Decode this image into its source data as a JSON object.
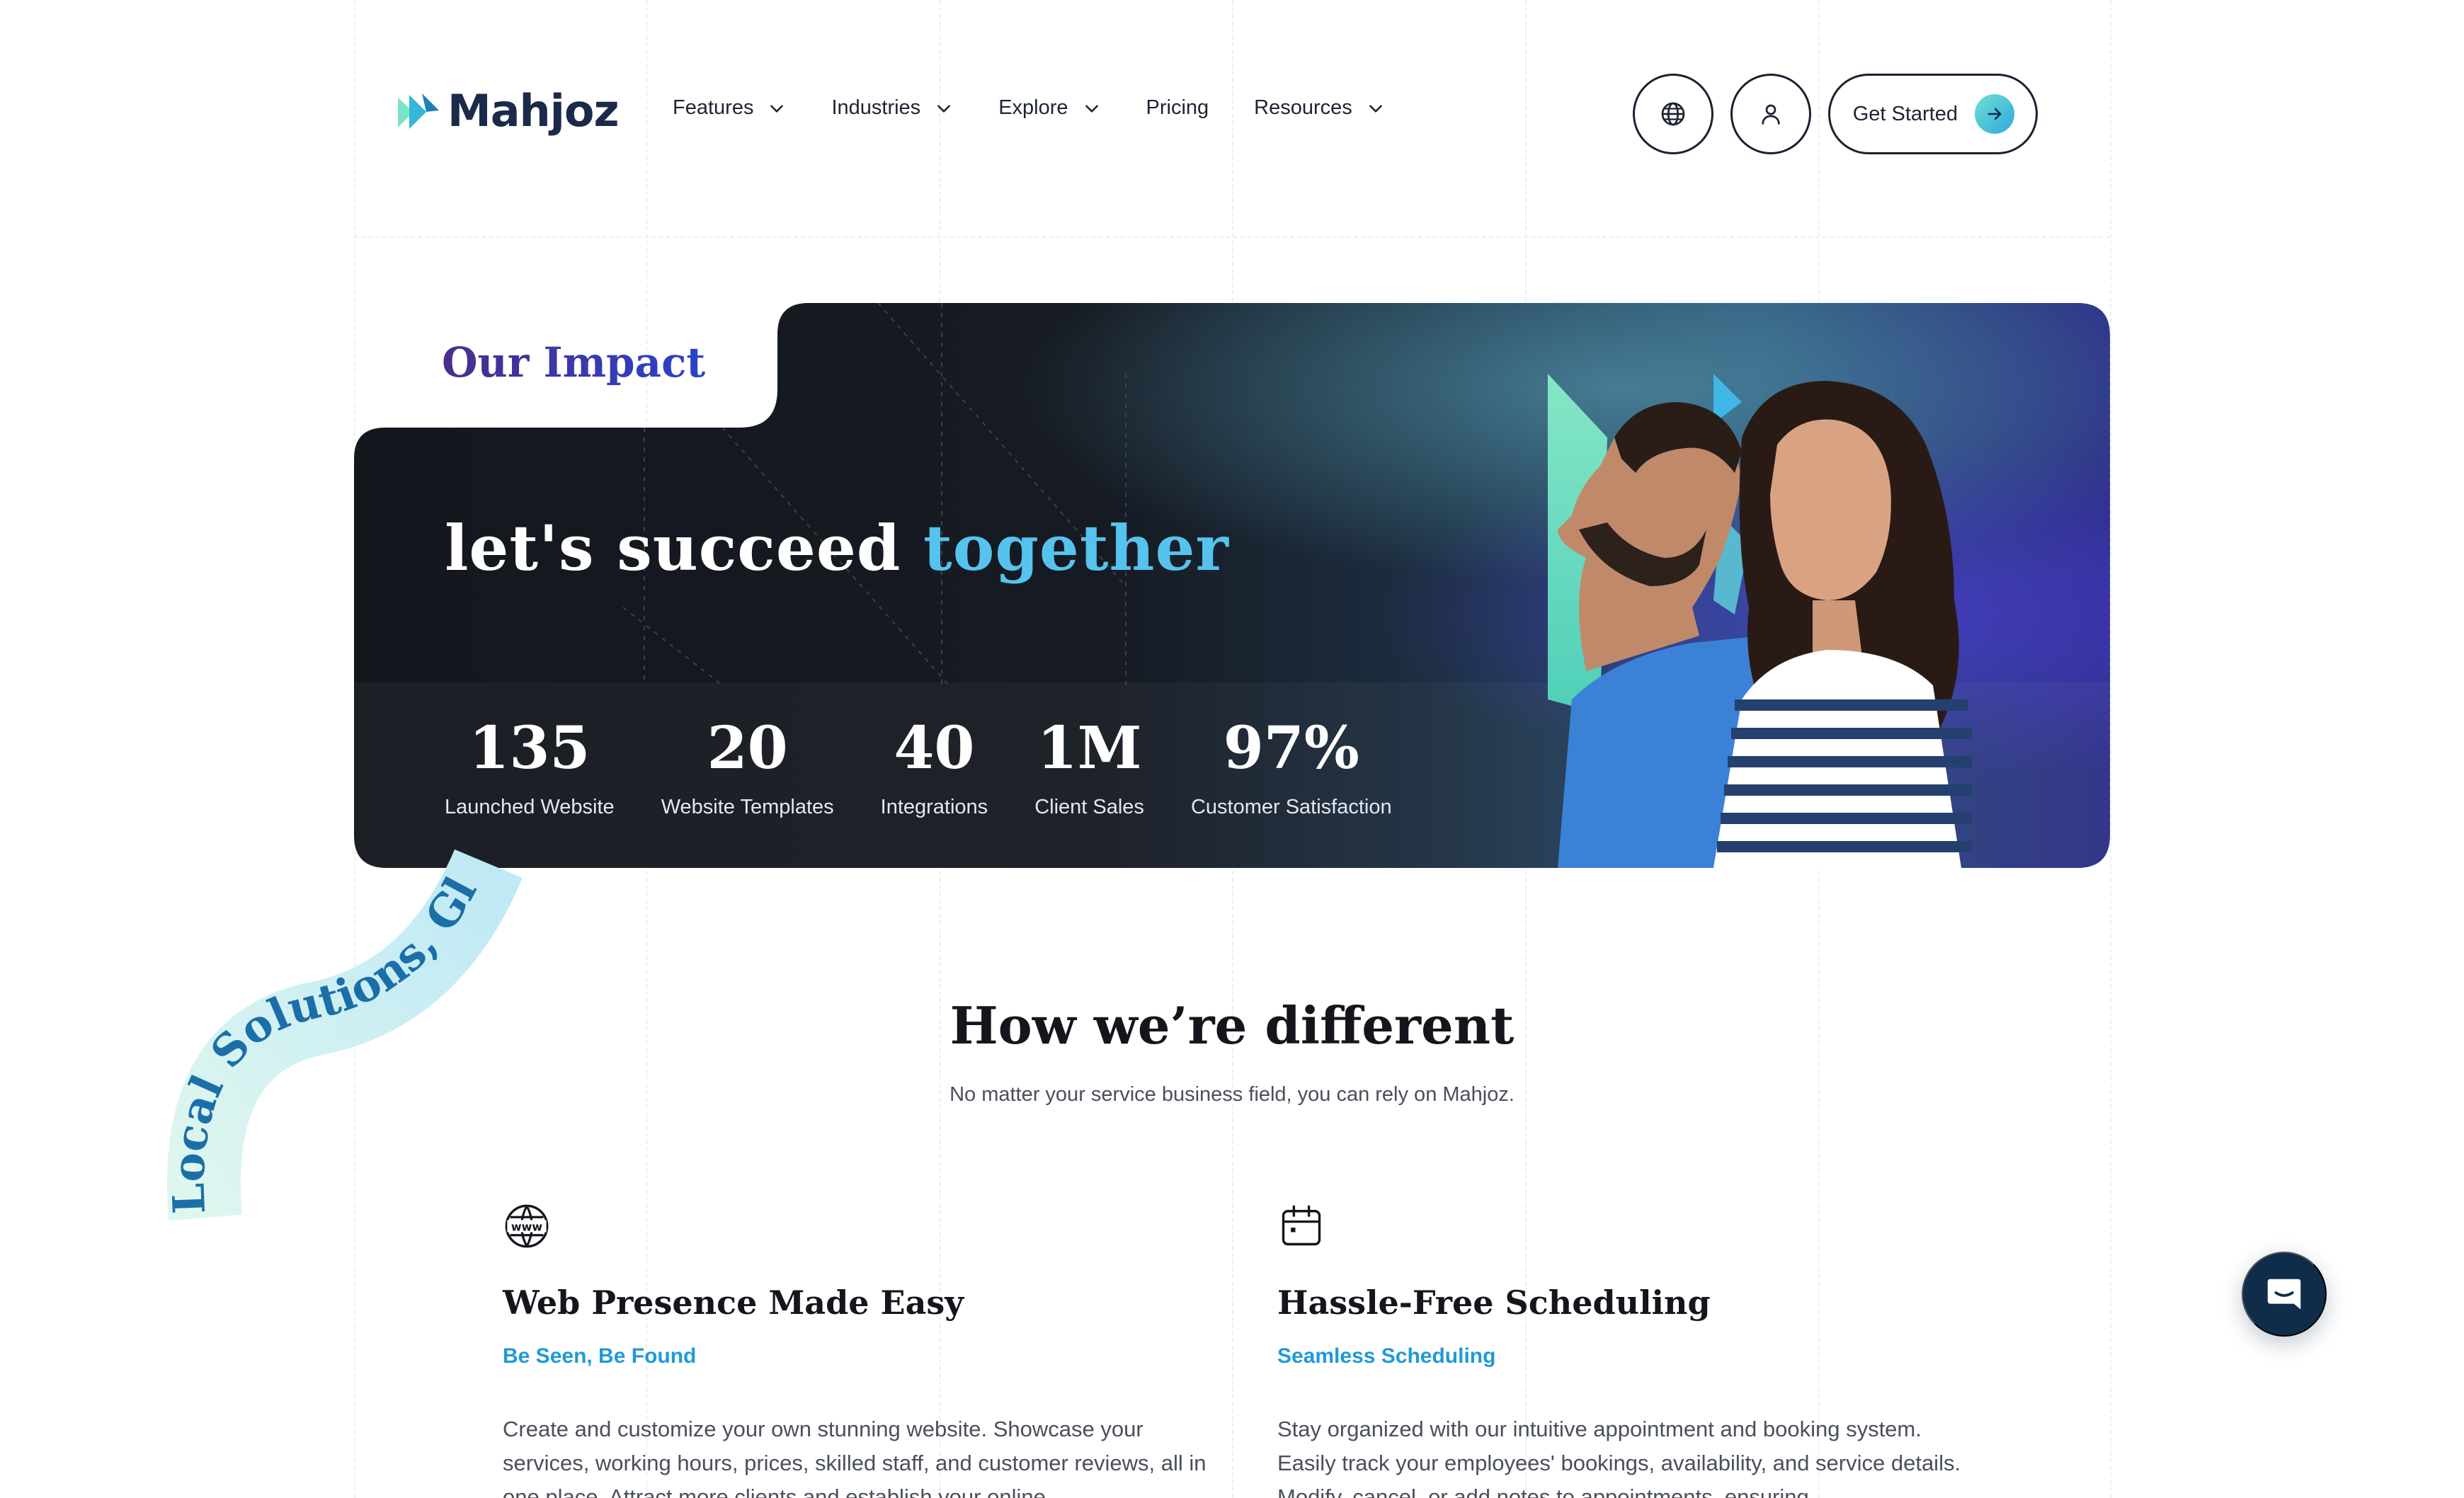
{
  "brand": {
    "name": "Mahjoz"
  },
  "nav": {
    "items": [
      {
        "label": "Features",
        "has_dropdown": true
      },
      {
        "label": "Industries",
        "has_dropdown": true
      },
      {
        "label": "Explore",
        "has_dropdown": true
      },
      {
        "label": "Pricing",
        "has_dropdown": false
      },
      {
        "label": "Resources",
        "has_dropdown": true
      }
    ],
    "language_icon": "globe-icon",
    "account_icon": "user-icon",
    "cta_label": "Get Started",
    "cta_icon": "arrow-right-icon"
  },
  "hero": {
    "section_label": "Our Impact",
    "title_main": "let's succeed ",
    "title_accent": "together",
    "stats": [
      {
        "value": "135",
        "label": "Launched Website"
      },
      {
        "value": "20",
        "label": "Website Templates"
      },
      {
        "value": "40",
        "label": "Integrations"
      },
      {
        "value": "1M",
        "label": "Client Sales"
      },
      {
        "value": "97%",
        "label": "Customer Satisfaction"
      }
    ]
  },
  "ribbon": {
    "text": "Local Solutions, Gl"
  },
  "different": {
    "title": "How we’re different",
    "subtitle": "No matter your service business field, you can rely on Mahjoz.",
    "features": [
      {
        "icon": "www-globe-icon",
        "title": "Web Presence Made Easy",
        "tagline": "Be Seen, Be Found",
        "text": "Create and customize your own stunning website. Showcase your services, working hours, prices, skilled staff, and customer reviews, all in one place. Attract more clients and establish your online"
      },
      {
        "icon": "calendar-icon",
        "title": "Hassle-Free Scheduling",
        "tagline": "Seamless Scheduling",
        "text": "Stay organized with our intuitive appointment and booking system. Easily track your employees' bookings, availability, and service details. Modify, cancel, or add notes to appointments, ensuring"
      }
    ]
  },
  "chat": {
    "icon": "chat-icon"
  },
  "colors": {
    "brand_dark": "#1b2a4a",
    "accent_blue": "#56c3ee",
    "accent_teal": "#6fe0d0",
    "hero_bg": "#14171e",
    "tag_blue": "#1f9ad6"
  }
}
